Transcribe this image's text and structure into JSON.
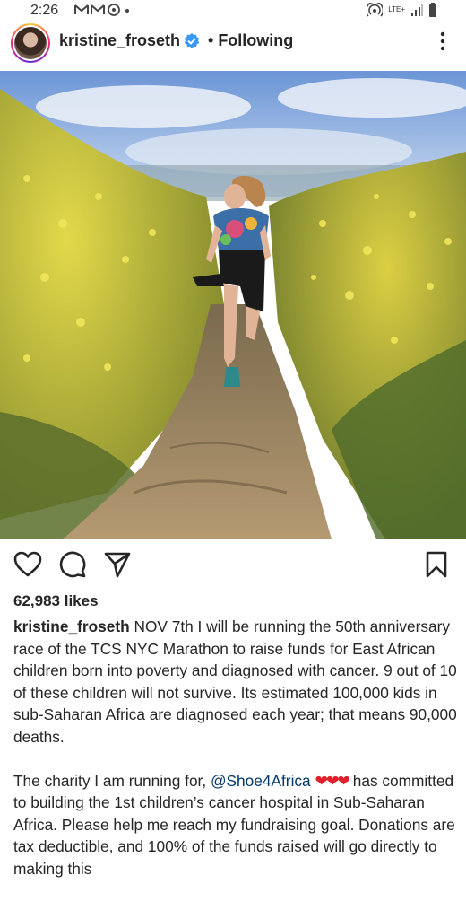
{
  "status_bar": {
    "time": "2:26",
    "network_label": "LTE+",
    "left_icons": [
      "gmail-icon",
      "gmail-icon",
      "sync-icon",
      "dot-icon"
    ],
    "right_icons": [
      "hotspot-icon",
      "signal-icon",
      "battery-icon"
    ]
  },
  "post": {
    "username": "kristine_froseth",
    "verified": true,
    "follow_state": "Following",
    "separator": "•",
    "likes": "62,983 likes",
    "caption": {
      "username": "kristine_froseth",
      "paragraph1": "NOV 7th I will be running the 50th anniversary race of the TCS NYC Marathon to raise funds for East African children born into poverty and diagnosed with cancer. 9 out of 10 of these children will not survive. Its estimated 100,000 kids in sub-Saharan Africa are diagnosed each year; that means 90,000 deaths.",
      "paragraph2_before": "The charity I am running for, ",
      "mention": "@Shoe4Africa",
      "hearts": "❤❤❤",
      "paragraph2_after": " has committed to building the 1st children’s cancer hospital in Sub-Saharan Africa. Please help me reach my fundraising goal.  Donations are tax deductible, and 100% of the funds raised will go directly to making this"
    }
  },
  "colors": {
    "text": "#262626",
    "mention": "#00376b",
    "verified": "#3897f0",
    "heart": "#e0202a"
  }
}
